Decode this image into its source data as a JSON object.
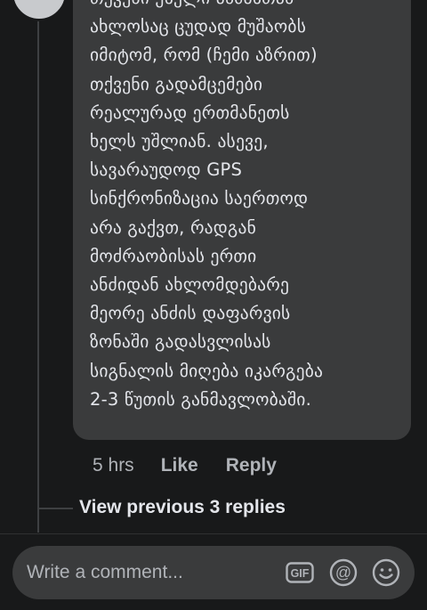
{
  "comment": {
    "text": "თქვენი ქსელი ანძასთან\nახლოსაც ცუდად მუშაობს\nიმიტომ, რომ (ჩემი აზრით)\nთქვენი გადამცემები\nრეალურად ერთმანეთს\nხელს უშლიან. ასევე,\nსავარაუდოდ GPS\nსინქრონიზაცია საერთოდ\nარა გაქვთ, რადგან\nმოძრაობისას ერთი\nანძიდან ახლომდებარე\nმეორე ანძის დაფარვის\nზონაში გადასვლისას\nსიგნალის მიღება იკარგება\n2-3 წუთის განმავლობაში.",
    "time": "5 hrs",
    "like_label": "Like",
    "reply_label": "Reply"
  },
  "view_previous_label": "View previous 3 replies",
  "composer": {
    "placeholder": "Write a comment...",
    "icons": [
      "gif-icon",
      "at-icon",
      "emoji-icon"
    ]
  },
  "colors": {
    "background": "#18191a",
    "bubble": "#3a3b3c",
    "text_primary": "#e4e6eb",
    "text_secondary": "#b0b3b8"
  }
}
